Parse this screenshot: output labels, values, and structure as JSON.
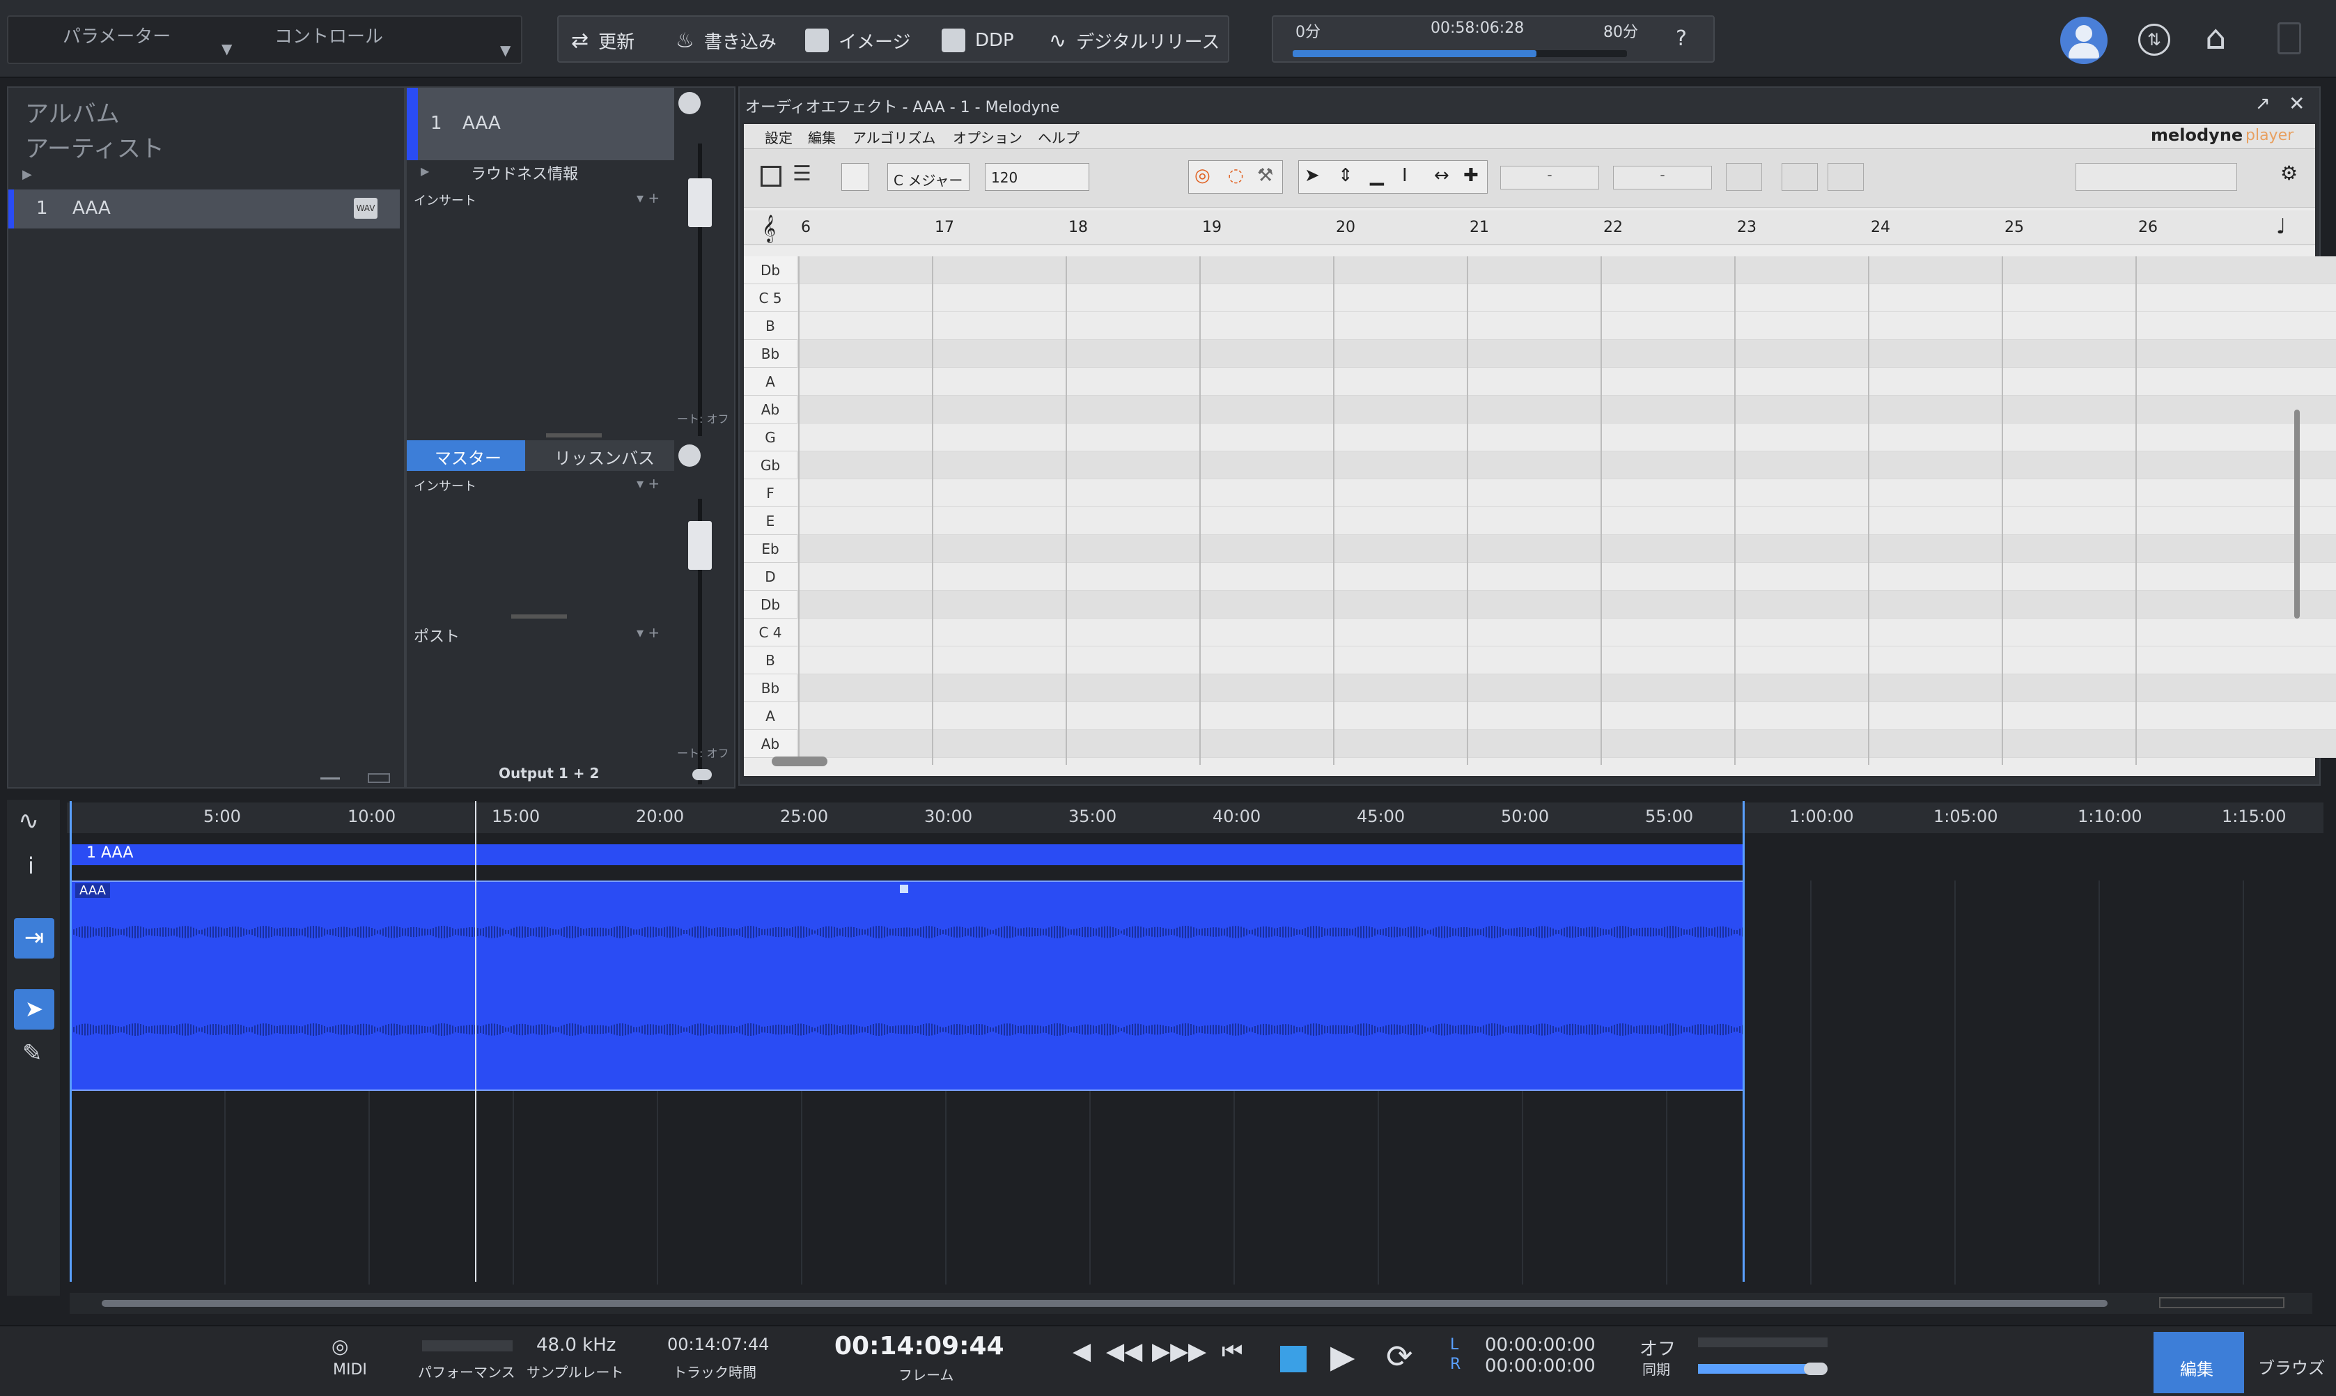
{
  "topbar": {
    "tab_parameters": "パラメーター",
    "tab_control": "コントロール",
    "buttons": [
      "更新",
      "書き込み",
      "イメージ",
      "DDP",
      "デジタルリリース"
    ],
    "progress_start": "0分",
    "progress_time": "00:58:06:28",
    "progress_end": "80分",
    "progress_fraction": 0.73,
    "help": "?"
  },
  "left_panel": {
    "album": "アルバム",
    "artist": "アーティスト",
    "track_number": "1",
    "track_name": "AAA",
    "track_badge": "WAV"
  },
  "mixer": {
    "track_number": "1",
    "track_name": "AAA",
    "loudness": "ラウドネス情報",
    "insert": "インサート",
    "auto_label": "ート: オフ",
    "tab_master": "マスター",
    "tab_listen": "リッスンバス",
    "insert2": "インサート",
    "post": "ポスト",
    "output": "Output 1 + 2"
  },
  "melodyne": {
    "title": "オーディオエフェクト - AAA - 1 - Melodyne",
    "menu": [
      "設定",
      "編集",
      "アルゴリズム",
      "オプション",
      "ヘルプ"
    ],
    "brand": "melodyne",
    "brand_sub": "player",
    "key": "C メジャー",
    "tempo": "120",
    "field_a": "-",
    "field_b": "-",
    "bars": [
      "6",
      "17",
      "18",
      "19",
      "20",
      "21",
      "22",
      "23",
      "24",
      "25",
      "26"
    ],
    "pitches": [
      "Db",
      "C 5",
      "B",
      "Bb",
      "A",
      "Ab",
      "G",
      "Gb",
      "F",
      "E",
      "Eb",
      "D",
      "Db",
      "C 4",
      "B",
      "Bb",
      "A",
      "Ab"
    ]
  },
  "arrange": {
    "ticks": [
      "5:00",
      "10:00",
      "15:00",
      "20:00",
      "25:00",
      "30:00",
      "35:00",
      "40:00",
      "45:00",
      "50:00",
      "55:00",
      "1:00:00",
      "1:05:00",
      "1:10:00",
      "1:15:00"
    ],
    "track_label": "1  AAA",
    "clip_label": "AAA",
    "info_icon": "i"
  },
  "transport": {
    "midi": "MIDI",
    "performance": "パフォーマンス",
    "sample_rate": "48.0 kHz",
    "sample_rate_label": "サンプルレート",
    "track_time": "00:14:07:44",
    "track_time_label": "トラック時間",
    "main_time": "00:14:09:44",
    "frame_label": "フレーム",
    "l": "L",
    "r": "R",
    "loop_start": "00:00:00:00",
    "loop_end": "00:00:00:00",
    "sync_state": "オフ",
    "sync_label": "同期",
    "edit": "編集",
    "browse": "ブラウズ"
  },
  "colors": {
    "accent_blue": "#2a4cf4",
    "progress_blue": "#3a7fd6",
    "tab_blue": "#3d7ed8"
  }
}
